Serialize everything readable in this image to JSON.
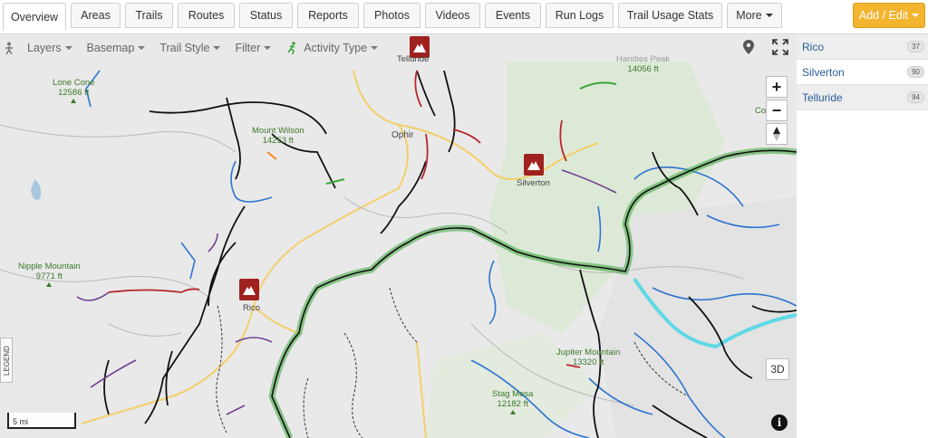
{
  "tabs": [
    {
      "label": "Overview",
      "active": true
    },
    {
      "label": "Areas"
    },
    {
      "label": "Trails"
    },
    {
      "label": "Routes"
    },
    {
      "label": "Status"
    },
    {
      "label": "Reports"
    },
    {
      "label": "Photos"
    },
    {
      "label": "Videos"
    },
    {
      "label": "Events"
    },
    {
      "label": "Run Logs"
    },
    {
      "label": "Trail Usage Stats"
    },
    {
      "label": "More"
    }
  ],
  "add_edit_label": "Add / Edit",
  "map_toolbar": {
    "layers": "Layers",
    "basemap": "Basemap",
    "trail_style": "Trail Style",
    "filter": "Filter",
    "activity_type": "Activity Type"
  },
  "map_controls": {
    "zoom_in": "+",
    "zoom_out": "−",
    "three_d": "3D",
    "info": "i",
    "legend": "LEGEND",
    "scale": "5 mi"
  },
  "map_labels": {
    "lone_cone": "Lone Cone",
    "lone_cone_elev": "12586 ft",
    "mount_wilson": "Mount Wilson",
    "mount_wilson_elev": "14253 ft",
    "nipple_mountain": "Nipple Mountain",
    "nipple_mountain_elev": "9771 ft",
    "handies_peak_elev": "14056 ft",
    "handies_peak": "Handies Peak",
    "ophir": "Ophir",
    "telluride": "Telluride",
    "silverton": "Silverton",
    "rico": "Rico",
    "jupiter_mountain": "Jupiter Mountain",
    "jupiter_mountain_elev": "13320 ft",
    "stag_mesa": "Stag Mesa",
    "stag_mesa_elev": "12182 ft",
    "edge_label": "Co"
  },
  "areas": [
    {
      "name": "Rico",
      "count": "37"
    },
    {
      "name": "Silverton",
      "count": "90"
    },
    {
      "name": "Telluride",
      "count": "94"
    }
  ],
  "colors": {
    "accent": "#f3b530",
    "link": "#2a5d9c",
    "town_pin": "#a0221e",
    "trail_black": "#111111",
    "trail_blue": "#2f74d0",
    "trail_green_halo": "#3aa63a",
    "trail_red": "#b8262b",
    "trail_purple": "#6e3f8f",
    "trail_cyan": "#33d6e6"
  }
}
